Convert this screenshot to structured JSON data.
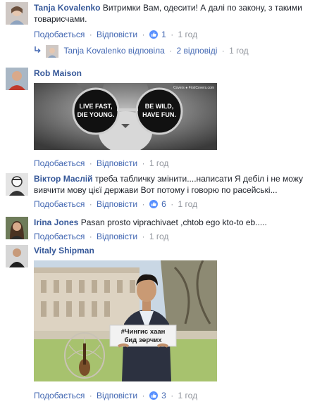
{
  "actions": {
    "like": "Подобається",
    "reply": "Відповісти",
    "sep": "·"
  },
  "comments": [
    {
      "author": "Tanja Kovalenko",
      "text": "Витримки Вам, одесити! А далі по закону, з такими товарисчами.",
      "likes": "1",
      "time": "1 год"
    },
    {
      "reply_summary": {
        "author": "Tanja Kovalenko",
        "verb": "відповіла",
        "count": "2 відповіді",
        "time": "1 год"
      }
    },
    {
      "author": "Rob Maison",
      "text": "",
      "image_watermark": "Covers ● FirstCovers.com",
      "lens_left": "LIVE FAST, DIE YOUNG.",
      "lens_right": "BE WILD, HAVE FUN.",
      "time": "1 год"
    },
    {
      "author": "Віктор Маслій",
      "text": "треба табличку змінити....написати Я дебіл і не можу вивчити мову цієї держави Вот потому і говорю по расейські...",
      "likes": "6",
      "time": "1 год"
    },
    {
      "author": "Irina Jones",
      "text": "Pasan prosto viprachivaet ,chtob ego kto-to eb.....",
      "time": "1 год"
    },
    {
      "author": "Vitaly Shipman",
      "text": "",
      "sign_line1": "#Чингис хаан",
      "sign_line2": "бид зөрчих",
      "likes": "3",
      "time": "1 год"
    }
  ],
  "colors": {
    "link_blue": "#4267b2",
    "author_blue": "#365899",
    "meta_gray": "#90949c",
    "like_blue": "#5890ff"
  }
}
